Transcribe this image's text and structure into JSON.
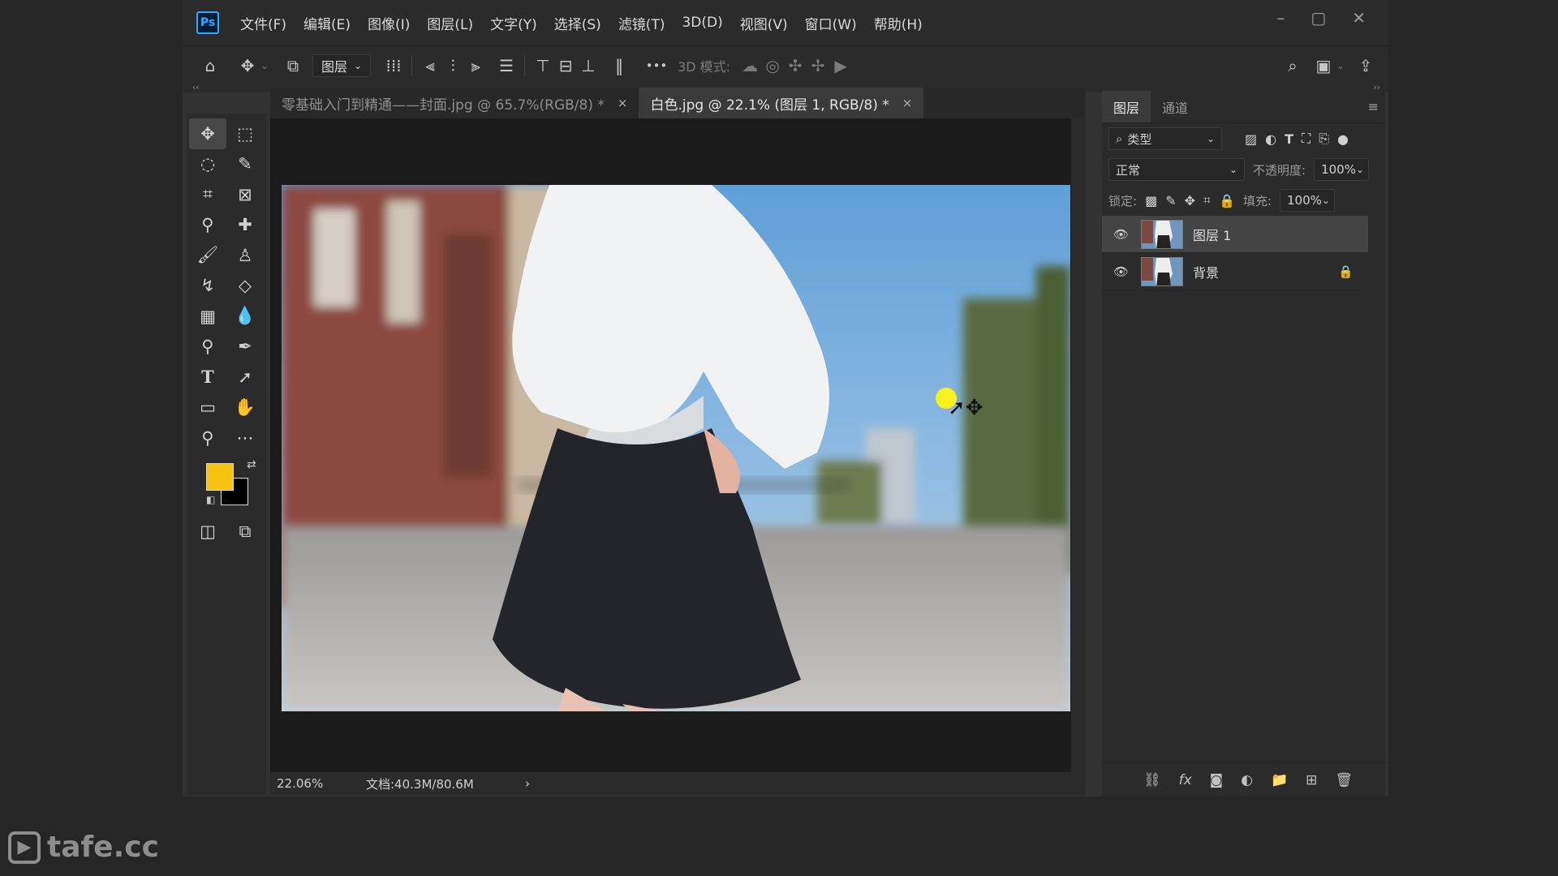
{
  "menubar": {
    "logo": "Ps",
    "items": [
      "文件(F)",
      "编辑(E)",
      "图像(I)",
      "图层(L)",
      "文字(Y)",
      "选择(S)",
      "滤镜(T)",
      "3D(D)",
      "视图(V)",
      "窗口(W)",
      "帮助(H)"
    ],
    "window_controls": [
      "–",
      "▢",
      "✕"
    ]
  },
  "options_bar": {
    "auto_select_target": "图层",
    "more": "•••",
    "mode_3d_label": "3D 模式:"
  },
  "tabs": [
    {
      "label": "零基础入门到精通——封面.jpg @ 65.7%(RGB/8) *",
      "close": "×"
    },
    {
      "label": "白色.jpg @ 22.1% (图层 1, RGB/8) *",
      "close": "×"
    }
  ],
  "status": {
    "zoom": "22.06%",
    "doc": "文档:40.3M/80.6M",
    "arrow": "›"
  },
  "colors": {
    "foreground": "#f6c20f",
    "background": "#000000"
  },
  "layers_panel": {
    "tabs": [
      "图层",
      "通道"
    ],
    "filter_label": "类型",
    "blend_mode": "正常",
    "opacity_label": "不透明度:",
    "opacity_value": "100%",
    "lock_label": "锁定:",
    "fill_label": "填充:",
    "fill_value": "100%",
    "layers": [
      {
        "name": "图层 1",
        "visible": true,
        "selected": true
      },
      {
        "name": "背景",
        "visible": true,
        "locked": true
      }
    ]
  },
  "watermark": "tafe.cc"
}
